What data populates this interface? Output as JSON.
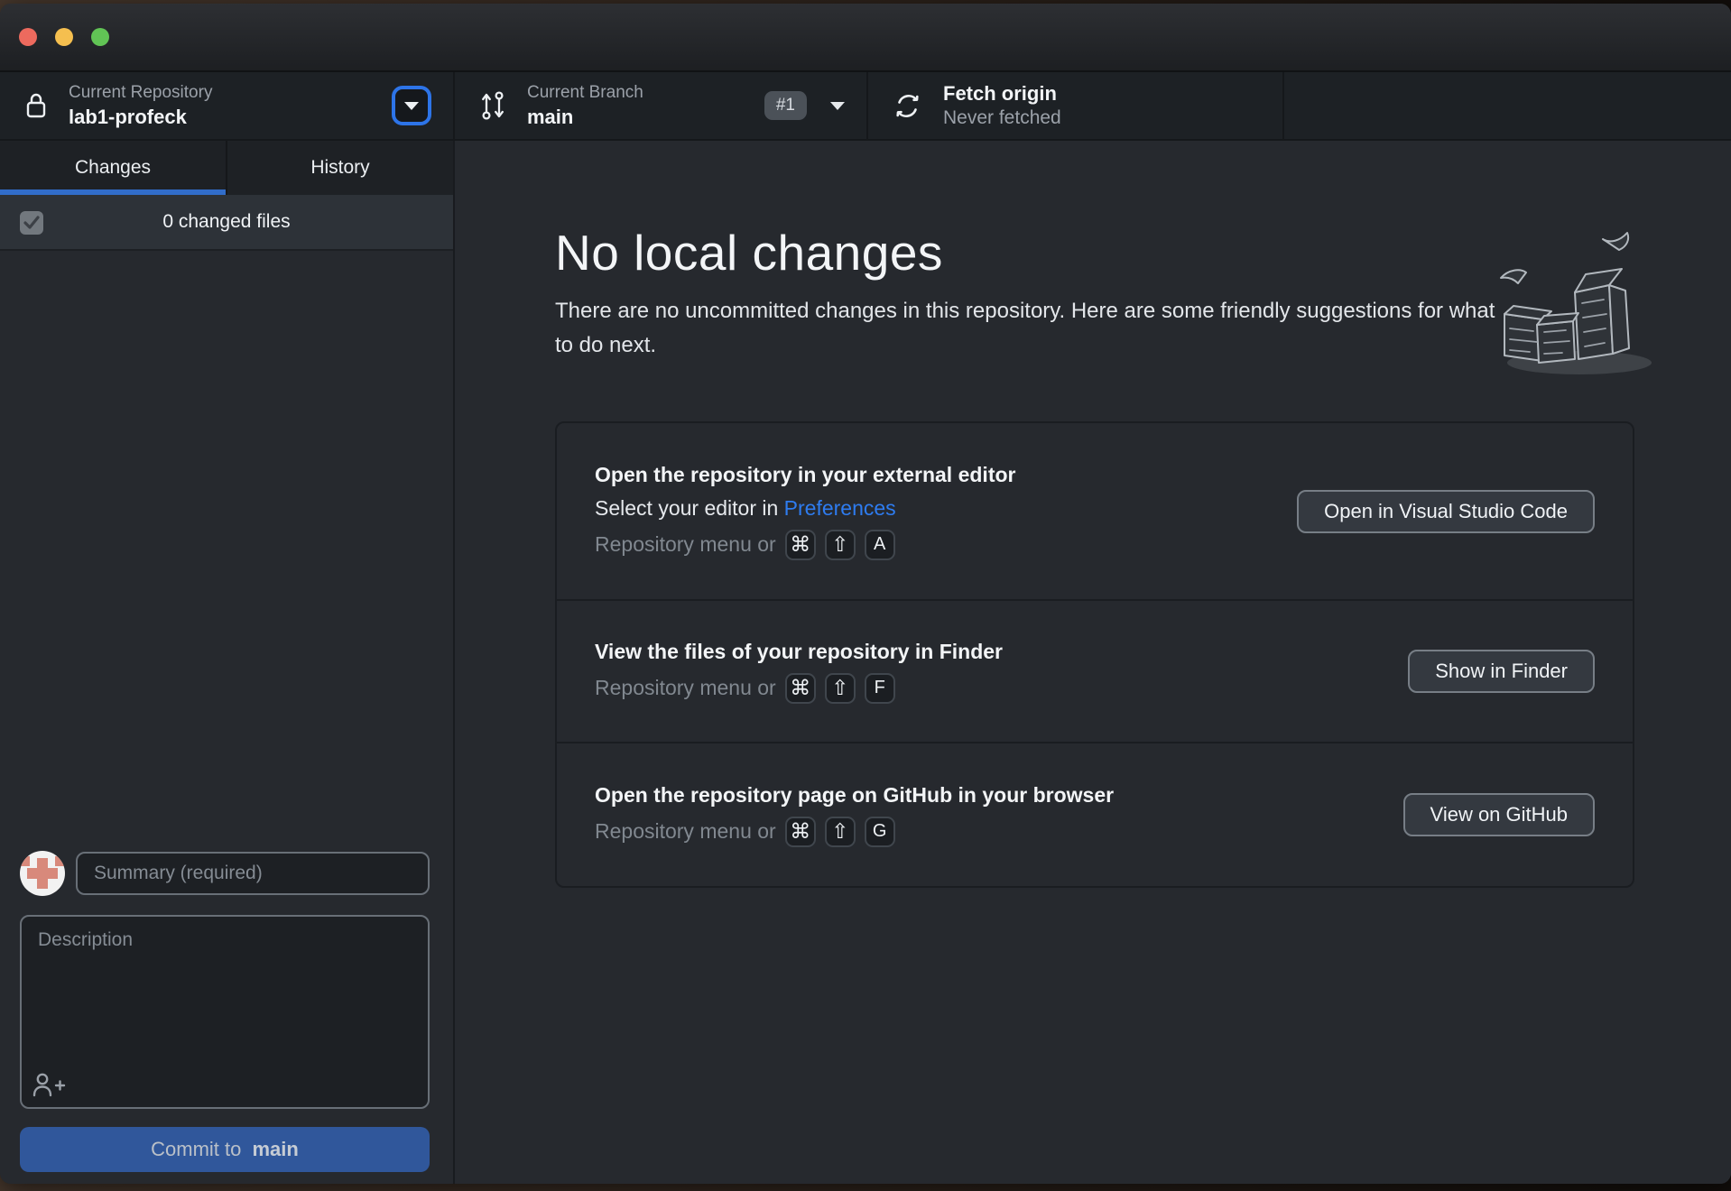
{
  "toolbar": {
    "repository": {
      "label": "Current Repository",
      "value": "lab1-profeck"
    },
    "branch": {
      "label": "Current Branch",
      "value": "main",
      "badge": "#1"
    },
    "fetch": {
      "label": "Fetch origin",
      "status": "Never fetched"
    }
  },
  "sidebar": {
    "tabs": [
      {
        "label": "Changes"
      },
      {
        "label": "History"
      }
    ],
    "active_tab": "Changes",
    "changed_files": "0 changed files",
    "summary_placeholder": "Summary (required)",
    "description_placeholder": "Description",
    "commit_label": "Commit to ",
    "commit_branch": "main"
  },
  "main": {
    "title": "No local changes",
    "subtitle": "There are no uncommitted changes in this repository. Here are some friendly suggestions for what to do next.",
    "cards": [
      {
        "title": "Open the repository in your external editor",
        "subtitle_prefix": "Select your editor in ",
        "subtitle_link": "Preferences",
        "shortcut_label": "Repository menu or",
        "keys": [
          "⌘",
          "⇧",
          "A"
        ],
        "button": "Open in Visual Studio Code"
      },
      {
        "title": "View the files of your repository in Finder",
        "shortcut_label": "Repository menu or",
        "keys": [
          "⌘",
          "⇧",
          "F"
        ],
        "button": "Show in Finder"
      },
      {
        "title": "Open the repository page on GitHub in your browser",
        "shortcut_label": "Repository menu or",
        "keys": [
          "⌘",
          "⇧",
          "G"
        ],
        "button": "View on GitHub"
      }
    ]
  },
  "colors": {
    "accent_blue": "#316dca",
    "link_blue": "#2e7cf0",
    "commit_button_blue": "#30579b",
    "focus_ring_blue": "#2d74e8",
    "traffic_red": "#ed6a5e",
    "traffic_yellow": "#f5bf4f",
    "traffic_green": "#61c455",
    "avatar_salmon": "#d8897b",
    "toolbar_bg": "#1d2125",
    "content_bg": "#26292e"
  }
}
